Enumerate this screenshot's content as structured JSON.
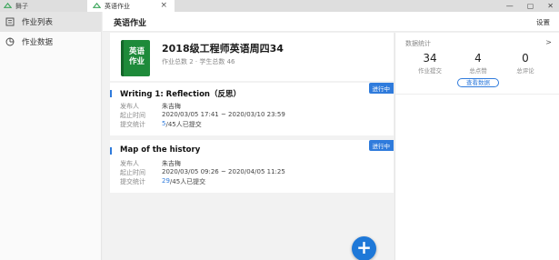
{
  "tabs": [
    {
      "label": "舞子"
    },
    {
      "label": "英语作业"
    }
  ],
  "sidebar": {
    "items": [
      {
        "label": "作业列表",
        "active": true,
        "icon": "list-icon"
      },
      {
        "label": "作业数据",
        "active": false,
        "icon": "pie-chart-icon"
      }
    ]
  },
  "header": {
    "title": "英语作业",
    "settings_label": "设置"
  },
  "course": {
    "cover_text_line1": "英语",
    "cover_text_line2": "作业",
    "title": "2018级工程师英语周四34",
    "meta": "作业总数 2 · 学生总数 46",
    "cover_color": "#1e8a3a"
  },
  "assignments": [
    {
      "title": "Writing 1: Reflection（反思）",
      "status": "进行中",
      "publisher_label": "发布人",
      "publisher": "朱吉梅",
      "period_label": "起止时间",
      "period": "2020/03/05 17:41 ~ 2020/03/10 23:59",
      "submit_label": "提交统计",
      "submitted": "5",
      "submit_rest": "/45人已提交"
    },
    {
      "title": "Map of the history",
      "status": "进行中",
      "publisher_label": "发布人",
      "publisher": "朱吉梅",
      "period_label": "起止时间",
      "period": "2020/03/05 09:26 ~ 2020/04/05 11:25",
      "submit_label": "提交统计",
      "submitted": "29",
      "submit_rest": "/45人已提交"
    }
  ],
  "fab_label": "+",
  "stats": {
    "title": "数据统计",
    "arrow": ">",
    "items": [
      {
        "value": "34",
        "label": "作业提交"
      },
      {
        "value": "4",
        "label": "总点赞"
      },
      {
        "value": "0",
        "label": "总评论"
      }
    ],
    "view_button": "查看数据"
  },
  "colors": {
    "accent": "#2f7bdc",
    "fab": "#1e78d8"
  }
}
